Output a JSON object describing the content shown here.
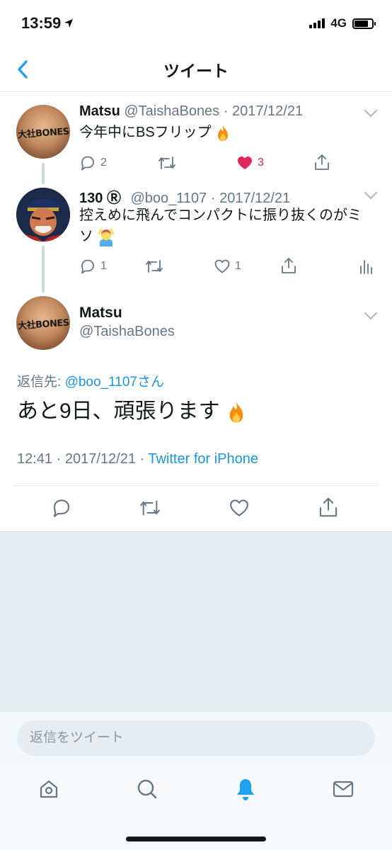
{
  "status_bar": {
    "time": "13:59",
    "network": "4G"
  },
  "nav": {
    "title": "ツイート"
  },
  "thread": [
    {
      "name": "Matsu",
      "handle": "@TaishaBones",
      "separator": " · ",
      "date": "2017/12/21",
      "text": "今年中にBSフリップ",
      "replies": "2",
      "retweets": "",
      "likes": "3",
      "avatar_text": "大社BONES"
    },
    {
      "name": "130",
      "badge": "Ⓡ",
      "handle": "@boo_1107",
      "separator": " · ",
      "date": "2017/12/21",
      "text_line1": "控えめに飛んでコンパクトに振り抜くのがミ",
      "text_line2": "ソ",
      "replies": "1",
      "retweets": "",
      "likes": "1"
    }
  ],
  "focus": {
    "name": "Matsu",
    "handle": "@TaishaBones",
    "avatar_text": "大社BONES",
    "reply_prefix": "返信先: ",
    "reply_handle": "@boo_1107さん",
    "text": "あと9日、頑張ります",
    "time": "12:41",
    "separator": " · ",
    "date": "2017/12/21",
    "separator2": " · ",
    "client": "Twitter for iPhone"
  },
  "compose": {
    "placeholder": "返信をツイート"
  },
  "colors": {
    "accent": "#1da1f2",
    "like": "#e0245e",
    "muted": "#657786",
    "gray_bg": "#e6ecf0"
  }
}
